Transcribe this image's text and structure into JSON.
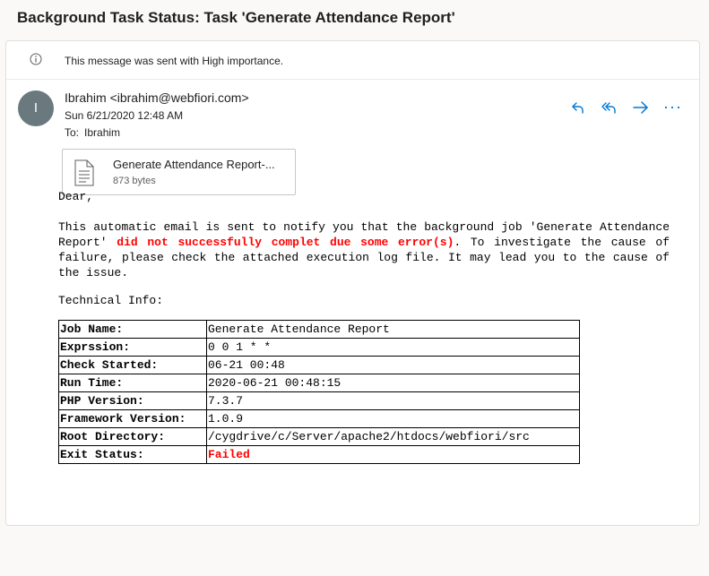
{
  "subject": "Background Task Status: Task 'Generate Attendance Report'",
  "importance_text": "This message was sent with High importance.",
  "sender": {
    "initial": "I",
    "name_email": "Ibrahim <ibrahim@webfiori.com>",
    "date": "Sun 6/21/2020 12:48 AM",
    "to_label": "To:",
    "to_value": "Ibrahim",
    "avatar_color": "#69797e"
  },
  "actions": {
    "reply_icon": "reply-icon",
    "reply_all_icon": "reply-all-icon",
    "forward_icon": "forward-icon",
    "more_icon": "more-icon"
  },
  "attachment": {
    "name": "Generate Attendance Report-...",
    "size": "873 bytes"
  },
  "body": {
    "greeting": "Dear,",
    "msg_part1": "This automatic email is sent to notify you that the background job 'Generate Attendance Report' ",
    "msg_red": "did not successfully complet due some error(s)",
    "msg_part2": ". To investigate the cause of failure, please check the attached execution log file. It may lead you to the cause of the issue.",
    "tech_label": "Technical Info:"
  },
  "tech_info": [
    {
      "key": "Job Name:",
      "value": "Generate Attendance Report"
    },
    {
      "key": "Exprssion:",
      "value": "0 0 1 * *"
    },
    {
      "key": "Check Started:",
      "value": "06-21 00:48"
    },
    {
      "key": "Run Time:",
      "value": "2020-06-21 00:48:15"
    },
    {
      "key": "PHP Version:",
      "value": "7.3.7"
    },
    {
      "key": "Framework Version:",
      "value": "1.0.9"
    },
    {
      "key": "Root Directory:",
      "value": "/cygdrive/c/Server/apache2/htdocs/webfiori/src"
    },
    {
      "key": "Exit Status:",
      "value": "Failed"
    }
  ],
  "colors": {
    "accent": "#0078d4",
    "error": "#ff0000"
  }
}
